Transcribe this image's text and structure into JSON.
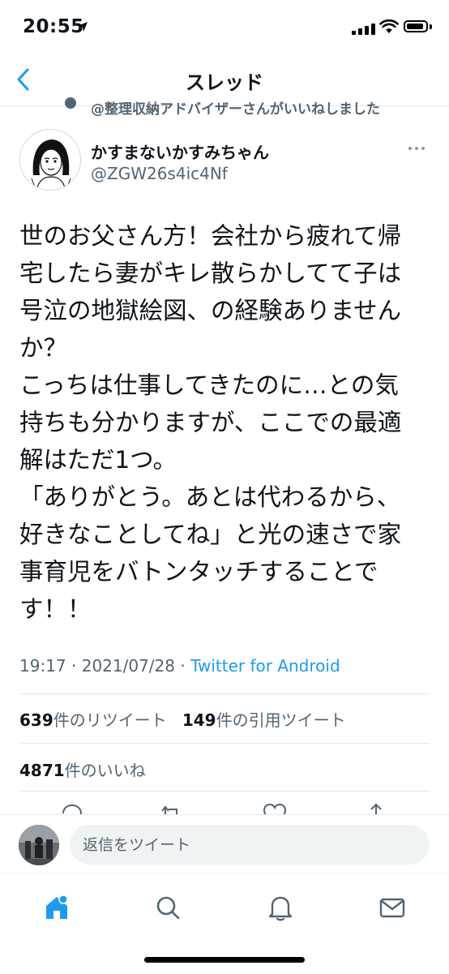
{
  "status_bar": {
    "time": "20:55"
  },
  "nav": {
    "title": "スレッド"
  },
  "social_context": "@整理収納アドバイザーさんがいいねしました",
  "author": {
    "name": "かすまないかすみちゃん",
    "handle": "@ZGW26s4ic4Nf"
  },
  "tweet": {
    "lines": [
      "世のお父さん方！会社から疲れて帰",
      "宅したら妻がキレ散らかしてて子は",
      "号泣の地獄絵図、の経験ありません",
      "か？",
      "こっちは仕事してきたのに…との気",
      "持ちも分かりますが、ここでの最適",
      "解はただ1つ。",
      "「ありがとう。あとは代わるから、",
      "好きなことしてね」と光の速さで家",
      "事育児をバトンタッチすることで",
      "す！！"
    ],
    "time": "19:17",
    "date": "2021/07/28",
    "separator": "·",
    "source": "Twitter for Android"
  },
  "stats": {
    "retweets_count": "639",
    "retweets_label": "件のリツイート",
    "quotes_count": "149",
    "quotes_label": "件の引用ツイート",
    "likes_count": "4871",
    "likes_label": "件のいいね"
  },
  "reply": {
    "placeholder": "返信をツイート"
  },
  "colors": {
    "accent": "#1d9bf0",
    "secondary_text": "#536471",
    "divider": "#e1e8ed"
  },
  "icons": {
    "back": "chevron-left-icon",
    "more": "more-icon",
    "tabs": [
      "home-icon",
      "search-icon",
      "bell-icon",
      "mail-icon"
    ]
  }
}
